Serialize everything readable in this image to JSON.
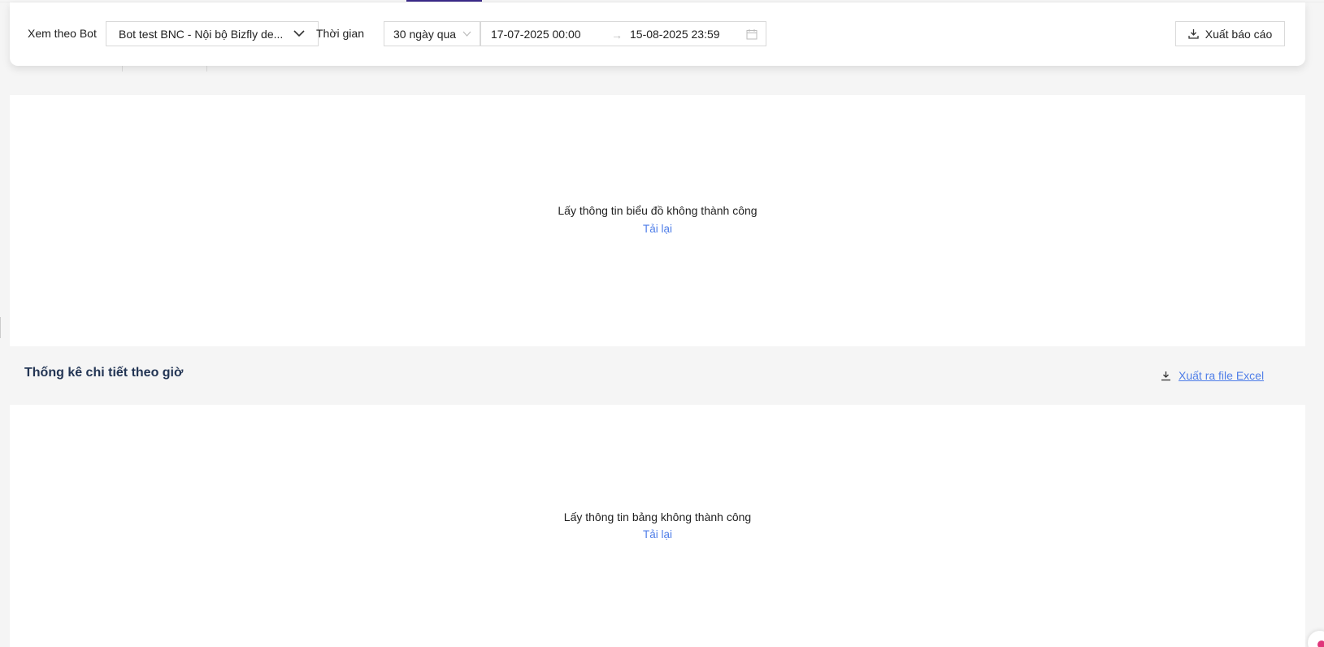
{
  "filters": {
    "bot_label": "Xem theo Bot",
    "bot_value": "Bot test BNC - Nội bộ Bizfly de...",
    "time_label": "Thời gian",
    "range_value": "30 ngày qua",
    "start_date": "17-07-2025 00:00",
    "end_date": "15-08-2025 23:59",
    "export_label": "Xuất báo cáo"
  },
  "chart_panel": {
    "error": "Lấy thông tin biểu đồ không thành công",
    "retry": "Tải lại"
  },
  "detail_section": {
    "title": "Thống kê chi tiết theo giờ",
    "excel_link": "Xuất ra file Excel"
  },
  "table_panel": {
    "error": "Lấy thông tin bảng không thành công",
    "retry": "Tải lại"
  },
  "colors": {
    "accent_link": "#4f7ee8",
    "title": "#233554",
    "active_tab": "#3b2a8a"
  },
  "icons": {
    "dropdown": "chevron-down-icon",
    "calendar": "calendar-icon",
    "download": "download-icon"
  }
}
